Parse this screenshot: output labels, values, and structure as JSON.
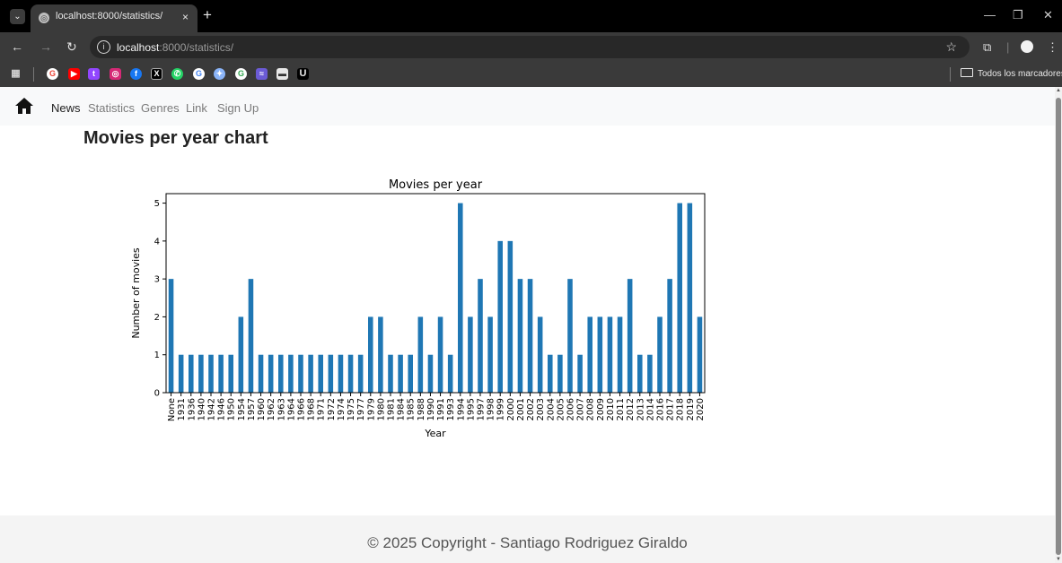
{
  "browser": {
    "tab_title": "localhost:8000/statistics/",
    "tab_close": "×",
    "new_tab": "+",
    "url_host": "localhost",
    "url_path": ":8000/statistics/",
    "bookmarks_folder": "Todos los marcadores",
    "bookmark_icons": [
      "google-icon",
      "youtube-icon",
      "twitch-icon",
      "instagram-icon",
      "facebook-icon",
      "x-icon",
      "whatsapp-icon",
      "google-icon",
      "gemini-icon",
      "google-icon",
      "lapse-icon",
      "monitor-icon",
      "u-icon"
    ],
    "accent": "#000000"
  },
  "site_nav": {
    "links": [
      "News",
      "Statistics",
      "Genres",
      "Link",
      "Sign Up"
    ],
    "active": "News"
  },
  "page": {
    "heading": "Movies per year chart"
  },
  "footer": {
    "text": "© 2025 Copyright - Santiago Rodriguez Giraldo"
  },
  "chart_data": {
    "type": "bar",
    "title": "Movies per year",
    "xlabel": "Year",
    "ylabel": "Number of movies",
    "ylim": [
      0,
      5.25
    ],
    "yticks": [
      0,
      1,
      2,
      3,
      4,
      5
    ],
    "grid": false,
    "color": "#1f77b4",
    "categories": [
      "None",
      "1931",
      "1936",
      "1940",
      "1942",
      "1946",
      "1950",
      "1954",
      "1957",
      "1960",
      "1962",
      "1963",
      "1964",
      "1966",
      "1968",
      "1971",
      "1972",
      "1974",
      "1975",
      "1977",
      "1979",
      "1980",
      "1981",
      "1984",
      "1985",
      "1988",
      "1990",
      "1991",
      "1993",
      "1994",
      "1995",
      "1997",
      "1998",
      "1999",
      "2000",
      "2001",
      "2002",
      "2003",
      "2004",
      "2005",
      "2006",
      "2007",
      "2008",
      "2009",
      "2010",
      "2011",
      "2012",
      "2013",
      "2014",
      "2016",
      "2017",
      "2018",
      "2019",
      "2020"
    ],
    "values": [
      3,
      1,
      1,
      1,
      1,
      1,
      1,
      2,
      3,
      1,
      1,
      1,
      1,
      1,
      1,
      1,
      1,
      1,
      1,
      1,
      2,
      2,
      1,
      1,
      1,
      2,
      1,
      2,
      1,
      5,
      2,
      3,
      2,
      4,
      4,
      3,
      3,
      2,
      1,
      1,
      3,
      1,
      2,
      2,
      2,
      2,
      3,
      1,
      1,
      2,
      3,
      5,
      5,
      2
    ]
  }
}
